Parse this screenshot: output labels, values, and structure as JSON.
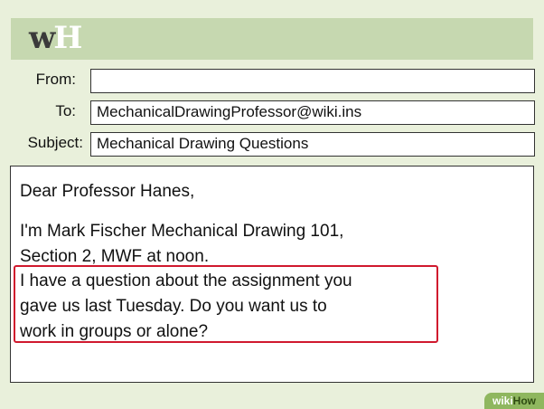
{
  "header": {
    "logo_w": "w",
    "logo_h": "H"
  },
  "fields": {
    "from_label": "From:",
    "from_value": "",
    "to_label": "To:",
    "to_value": "MechanicalDrawingProfessor@wiki.ins",
    "subject_label": "Subject:",
    "subject_value": "Mechanical Drawing Questions"
  },
  "message": {
    "greeting": "Dear Professor Hanes,",
    "intro_line1": "I'm Mark Fischer Mechanical Drawing 101,",
    "intro_line2": "Section 2, MWF at noon.",
    "question_line1": "I have a question about the assignment you",
    "question_line2": "gave us last Tuesday. Do you want us to",
    "question_line3": "work in groups or alone?"
  },
  "watermark": {
    "wiki": "wiki",
    "how": "How"
  },
  "colors": {
    "highlight": "#d0192e",
    "header": "#c6d8b0",
    "background": "#e9f0db"
  }
}
